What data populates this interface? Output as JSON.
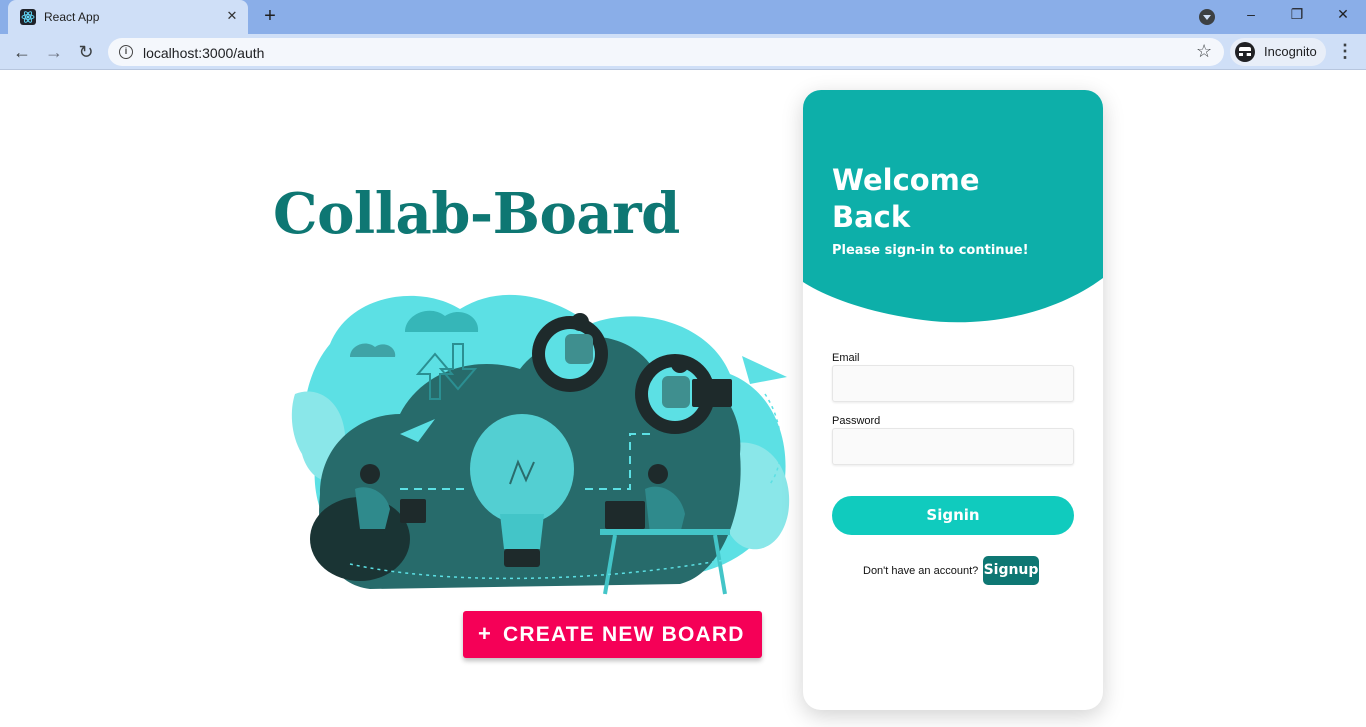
{
  "browser": {
    "tab_title": "React App",
    "tab_close_glyph": "✕",
    "new_tab_glyph": "+",
    "url": "localhost:3000/auth",
    "profile_label": "Incognito",
    "window_minimize": "–",
    "window_maximize": "❐",
    "window_close": "✕",
    "back_glyph": "←",
    "forward_glyph": "→",
    "reload_glyph": "↻",
    "star_glyph": "☆",
    "menu_glyph": "⋮",
    "info_glyph": "i"
  },
  "hero": {
    "title": "Collab-Board",
    "illustration": "team-collaboration-cloud-illustration"
  },
  "create_button": {
    "icon": "+",
    "label": "CREATE NEW BOARD"
  },
  "auth": {
    "heading": "Welcome Back",
    "subtitle": "Please sign-in to continue!",
    "email_label": "Email",
    "email_value": "",
    "password_label": "Password",
    "password_value": "",
    "signin_label": "Signin",
    "no_account_text": "Don't have an account?",
    "signup_label": "Signup"
  },
  "colors": {
    "brand_teal": "#0e7773",
    "header_teal": "#0dafa9",
    "signin_teal": "#10cbbe",
    "create_pink": "#f50057",
    "tabbar_blue": "#8aaee8",
    "toolbar_blue": "#cfdff7"
  }
}
